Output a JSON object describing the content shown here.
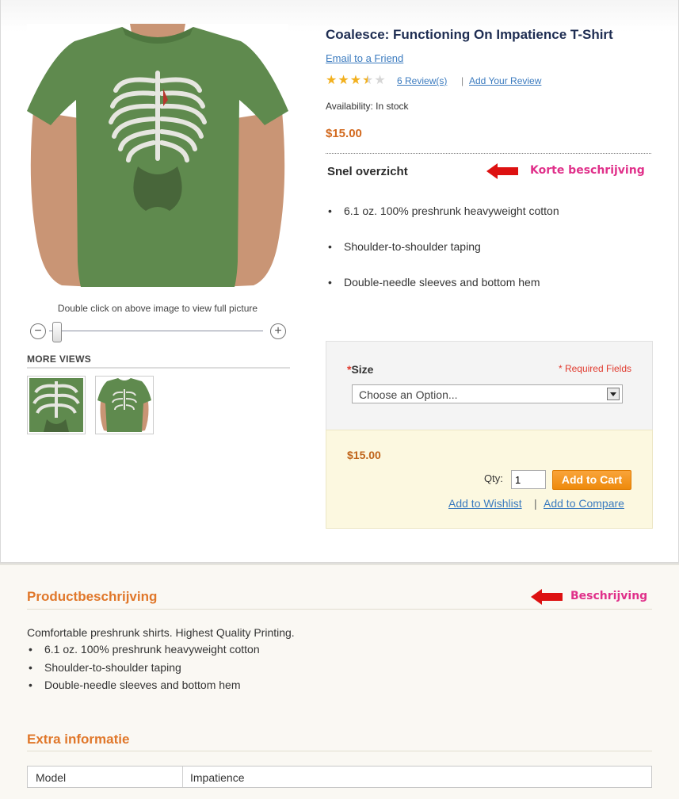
{
  "product": {
    "title": "Coalesce: Functioning On Impatience T-Shirt",
    "email_link": "Email to a Friend",
    "rating_stars": 3.5,
    "reviews_link": "6 Review(s)",
    "separator": "|",
    "add_review_link": "Add Your Review",
    "availability": "Availability: In stock",
    "price": "$15.00"
  },
  "image": {
    "hint": "Double click on above image to view  full picture",
    "zoom_minus": "−",
    "zoom_plus": "+",
    "more_views": "MORE VIEWS"
  },
  "quick_overview": {
    "title": "Snel overzicht",
    "annotation": "Korte beschrijving",
    "bullets": [
      "6.1 oz. 100% preshrunk heavyweight cotton",
      "Shoulder-to-shoulder taping",
      "Double-needle sleeves and bottom hem"
    ]
  },
  "options": {
    "size_label": "Size",
    "required_marker": "*",
    "required_note": "* Required Fields",
    "select_value": "Choose an Option..."
  },
  "cart": {
    "price": "$15.00",
    "qty_label": "Qty:",
    "qty_value": "1",
    "add_to_cart": "Add to Cart",
    "wishlist": "Add to Wishlist",
    "separator": "|",
    "compare": "Add to Compare"
  },
  "description": {
    "title": "Productbeschrijving",
    "annotation": "Beschrijving",
    "text": "Comfortable preshrunk shirts. Highest Quality Printing.",
    "bullets": [
      "6.1 oz. 100% preshrunk heavyweight cotton",
      "Shoulder-to-shoulder taping",
      "Double-needle sleeves and bottom hem"
    ]
  },
  "extra": {
    "title": "Extra informatie",
    "rows": [
      {
        "key": "Model",
        "value": "Impatience"
      }
    ]
  },
  "colors": {
    "shirt": "#5f8a4e",
    "accent_orange": "#e0772a",
    "link_blue": "#3b7bbf",
    "annotation_pink": "#e0308a",
    "arrow_red": "#dd1111"
  }
}
